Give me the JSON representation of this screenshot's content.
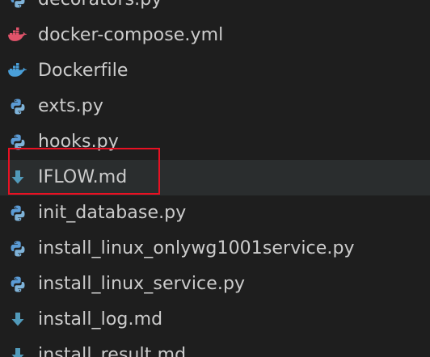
{
  "colors": {
    "background": "#1e1e1e",
    "selected_row": "#2a2d2e",
    "text": "#cccccc",
    "python_blue": "#5b9bd5",
    "python_yellow": "#7fb3d9",
    "docker_compose": "#e0536a",
    "docker": "#4a9fd8",
    "markdown": "#519aba",
    "highlight": "#e81123"
  },
  "files": [
    {
      "name": "decorators.py",
      "icon": "python-icon"
    },
    {
      "name": "docker-compose.yml",
      "icon": "docker-compose-icon"
    },
    {
      "name": "Dockerfile",
      "icon": "docker-icon"
    },
    {
      "name": "exts.py",
      "icon": "python-icon"
    },
    {
      "name": "hooks.py",
      "icon": "python-icon"
    },
    {
      "name": "IFLOW.md",
      "icon": "markdown-download-icon",
      "selected": true
    },
    {
      "name": "init_database.py",
      "icon": "python-icon"
    },
    {
      "name": "install_linux_onlywg1001service.py",
      "icon": "python-icon"
    },
    {
      "name": "install_linux_service.py",
      "icon": "python-icon"
    },
    {
      "name": "install_log.md",
      "icon": "markdown-download-icon"
    },
    {
      "name": "install_result.md",
      "icon": "markdown-download-icon"
    }
  ]
}
